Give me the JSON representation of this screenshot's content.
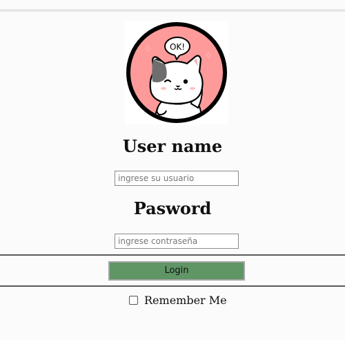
{
  "avatar": {
    "bubble_text": "OK!"
  },
  "form": {
    "username_heading": "User name",
    "username_placeholder": "ingrese su usuario",
    "password_heading": "Pasword",
    "password_placeholder": "ingrese contraseña",
    "login_label": "Login",
    "remember_label": "Remember Me"
  },
  "colors": {
    "avatar_circle": "#ff9a9a",
    "avatar_ring": "#000000",
    "login_button": "#609566"
  },
  "icons": [
    "cat-mascot-icon",
    "speech-bubble-icon",
    "checkbox-icon"
  ]
}
